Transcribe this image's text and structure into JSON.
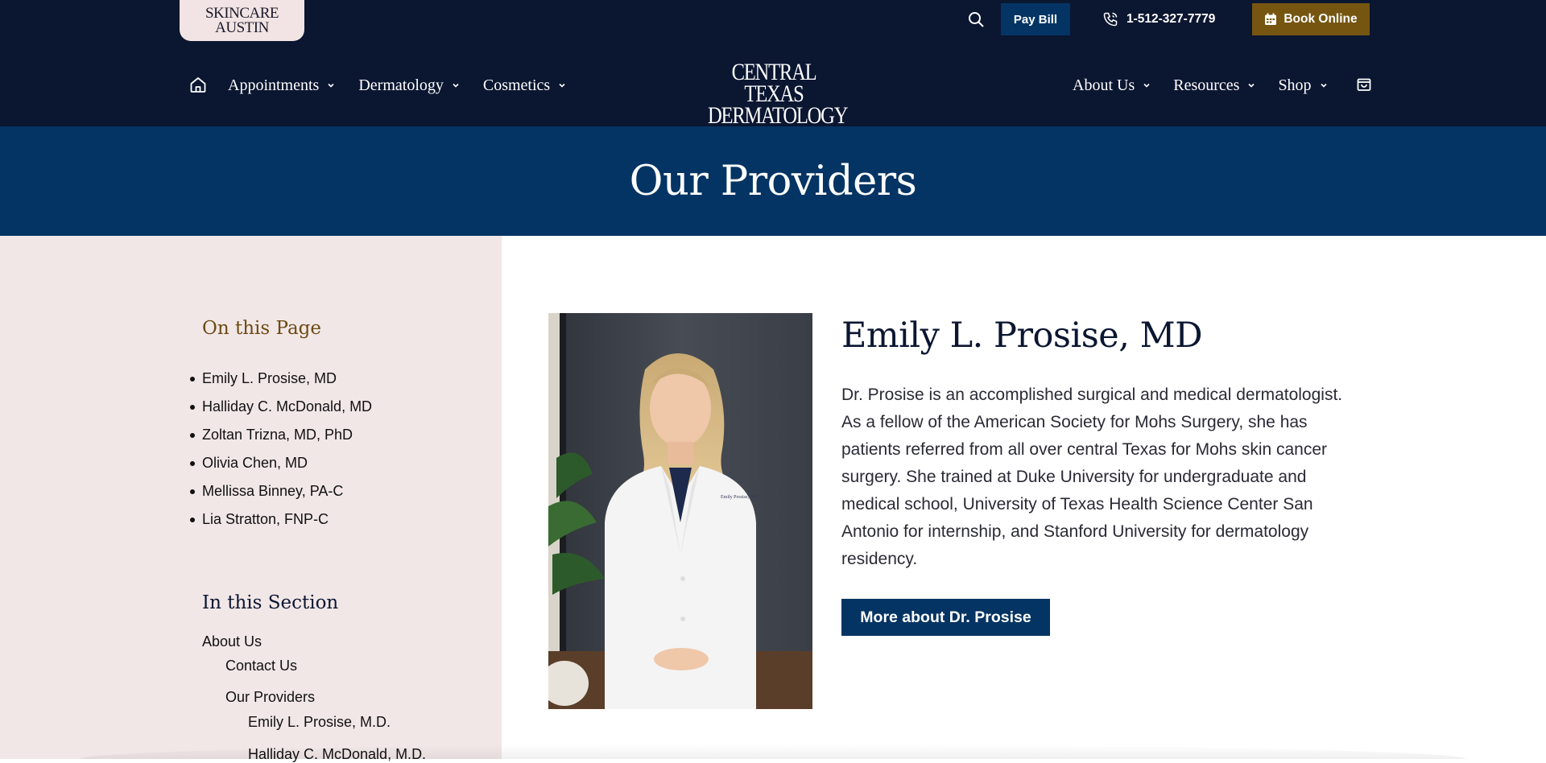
{
  "header": {
    "badge": {
      "line1": "SKINCARE",
      "line2": "AUSTIN"
    },
    "utility": {
      "pay_bill": "Pay Bill",
      "phone": "1-512-327-7779",
      "book_online": "Book Online"
    },
    "logo": {
      "line1": "CENTRAL TEXAS",
      "line2": "DERMATOLOGY"
    },
    "nav_left": [
      {
        "label": "Appointments"
      },
      {
        "label": "Dermatology"
      },
      {
        "label": "Cosmetics"
      }
    ],
    "nav_right": [
      {
        "label": "About Us"
      },
      {
        "label": "Resources"
      },
      {
        "label": "Shop"
      }
    ],
    "icons": {
      "home": "home-icon",
      "search": "search-icon",
      "phone": "phone-icon",
      "calendar": "calendar-icon",
      "cart": "shopping-bag-icon",
      "chevron": "chevron-down-icon"
    }
  },
  "hero": {
    "title": "Our Providers"
  },
  "sidebar": {
    "on_this_page_title": "On this Page",
    "on_this_page": [
      "Emily L. Prosise, MD",
      "Halliday C. McDonald, MD",
      "Zoltan Trizna, MD, PhD",
      "Olivia Chen, MD",
      "Mellissa Binney, PA-C",
      "Lia Stratton, FNP-C"
    ],
    "in_this_section_title": "In this Section",
    "section_links": {
      "about_us": "About Us",
      "contact_us": "Contact Us",
      "our_providers": "Our Providers",
      "emily": "Emily L. Prosise, M.D.",
      "halliday": "Halliday C. McDonald, M.D."
    }
  },
  "provider": {
    "name": "Emily L. Prosise, MD",
    "bio": "Dr. Prosise is an accomplished surgical and medical dermatologist. As a fellow of the American Society for Mohs Surgery, she has patients referred from all over central Texas for Mohs skin cancer surgery. She trained at Duke University for undergraduate and medical school, University of Texas Health Science Center San Antonio for internship, and Stanford University for dermatology residency.",
    "button": "More about Dr. Prosise",
    "coat_embroidery": "Emily Prosise, MD"
  },
  "colors": {
    "header_bg": "#0b1631",
    "hero_bg": "#043463",
    "book_bg": "#755510",
    "sidebar_bg": "#f2e7e7",
    "accent_gold": "#6d4a13"
  }
}
